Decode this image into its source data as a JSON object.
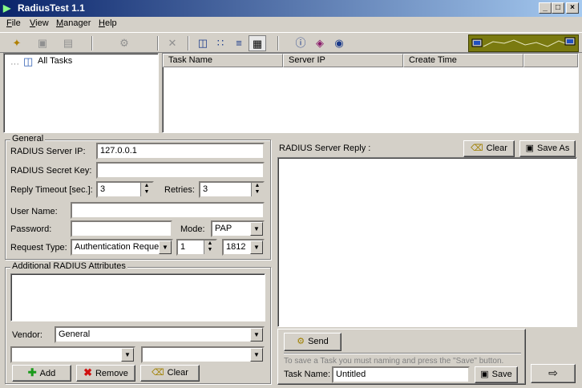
{
  "window": {
    "title": "RadiusTest 1.1",
    "accent": "#0a246a"
  },
  "menu": {
    "file": "File",
    "view": "View",
    "manager": "Manager",
    "help": "Help"
  },
  "tree": {
    "root": "All Tasks"
  },
  "table": {
    "columns": [
      "Task Name",
      "Server IP",
      "Create Time"
    ]
  },
  "general": {
    "legend": "General",
    "server_ip_label": "RADIUS Server IP:",
    "server_ip": "127.0.0.1",
    "secret_label": "RADIUS Secret Key:",
    "secret": "",
    "timeout_label": "Reply Timeout [sec.]:",
    "timeout": "3",
    "retries_label": "Retries:",
    "retries": "3",
    "user_label": "User Name:",
    "user": "",
    "password_label": "Password:",
    "password": "",
    "mode_label": "Mode:",
    "mode": "PAP",
    "request_type_label": "Request Type:",
    "request_type": "Authentication Reques",
    "request_id": "1",
    "port": "1812"
  },
  "attributes": {
    "legend": "Additional RADIUS Attributes",
    "vendor_label": "Vendor:",
    "vendor": "General",
    "add": "Add",
    "remove": "Remove",
    "clear": "Clear"
  },
  "reply": {
    "label": "RADIUS Server Reply :",
    "clear": "Clear",
    "save_as": "Save As"
  },
  "task": {
    "send": "Send",
    "hint": "To save a Task you must naming and press the \"Save\" button.",
    "name_label": "Task Name:",
    "name": "Untitled",
    "save": "Save"
  }
}
